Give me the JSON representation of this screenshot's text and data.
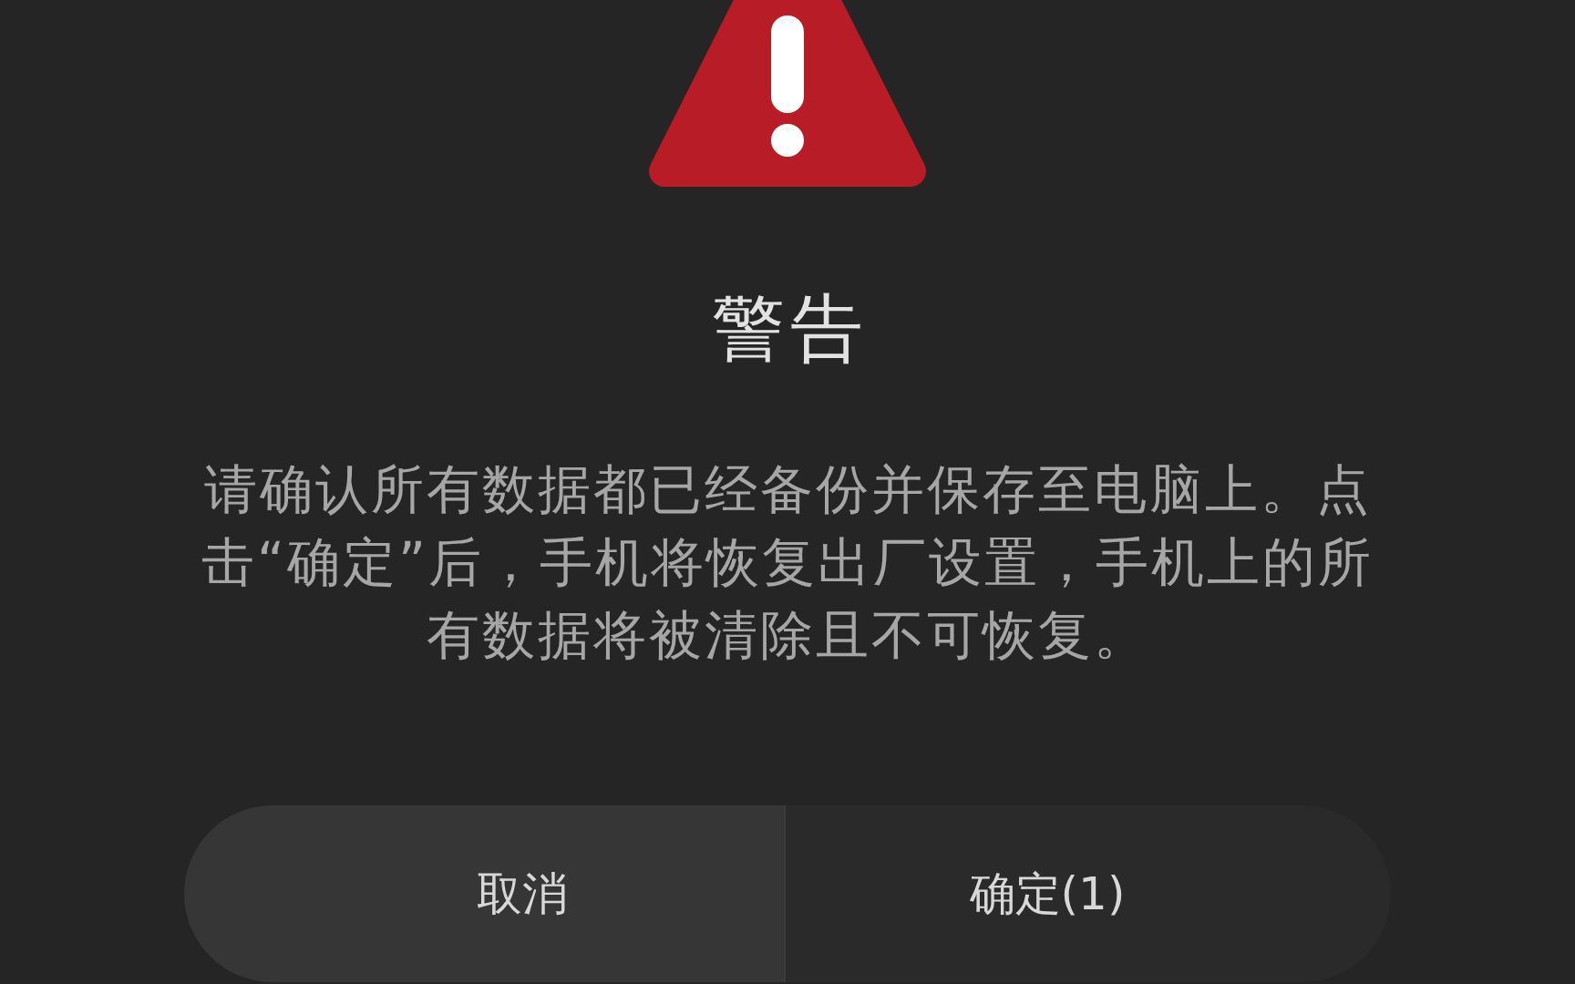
{
  "dialog": {
    "title": "警告",
    "message": "请确认所有数据都已经备份并保存至电脑上。点击“确定”后，手机将恢复出厂设置，手机上的所有数据将被清除且不可恢复。",
    "buttons": [
      {
        "label": "取消",
        "highlighted": true
      },
      {
        "label": "确定(1)",
        "highlighted": false
      }
    ]
  }
}
